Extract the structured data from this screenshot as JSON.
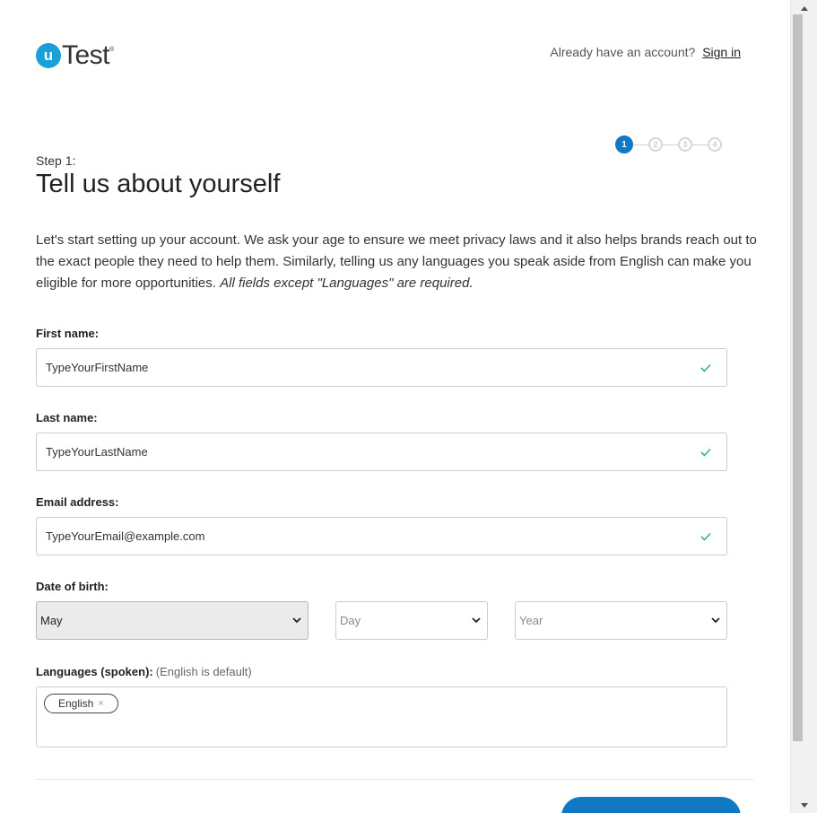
{
  "header": {
    "logo_letter": "u",
    "logo_text": "Test",
    "logo_registered": "®",
    "account_prompt": "Already have an account?",
    "signin_label": "Sign in"
  },
  "steps": {
    "items": [
      "1",
      "2",
      "3",
      "4"
    ],
    "active": 1
  },
  "intro": {
    "step_label": "Step 1:",
    "title": "Tell us about yourself",
    "text": "Let's start setting up your account. We ask your age to ensure we meet privacy laws and it also helps brands reach out to the exact people they need to help them. Similarly, telling us any languages you speak aside from English can make you eligible for more opportunities.",
    "required_note": "All fields except \"Languages\" are required."
  },
  "form": {
    "first_name": {
      "label": "First name:",
      "value": "TypeYourFirstName",
      "valid": true
    },
    "last_name": {
      "label": "Last name:",
      "value": "TypeYourLastName",
      "valid": true
    },
    "email": {
      "label": "Email address:",
      "value": "TypeYourEmail@example.com",
      "valid": true
    },
    "dob": {
      "label": "Date of birth:",
      "month": "May",
      "day_placeholder": "Day",
      "year_placeholder": "Year"
    },
    "languages": {
      "label": "Languages (spoken):",
      "hint": "(English is default)",
      "tags": [
        "English"
      ],
      "remove_symbol": "×"
    }
  },
  "colors": {
    "brand": "#1a9fd6",
    "primary": "#1079c2",
    "valid_check": "#3cb371"
  },
  "icons": {
    "check": "check-icon",
    "chevron": "chevron-down-icon"
  }
}
